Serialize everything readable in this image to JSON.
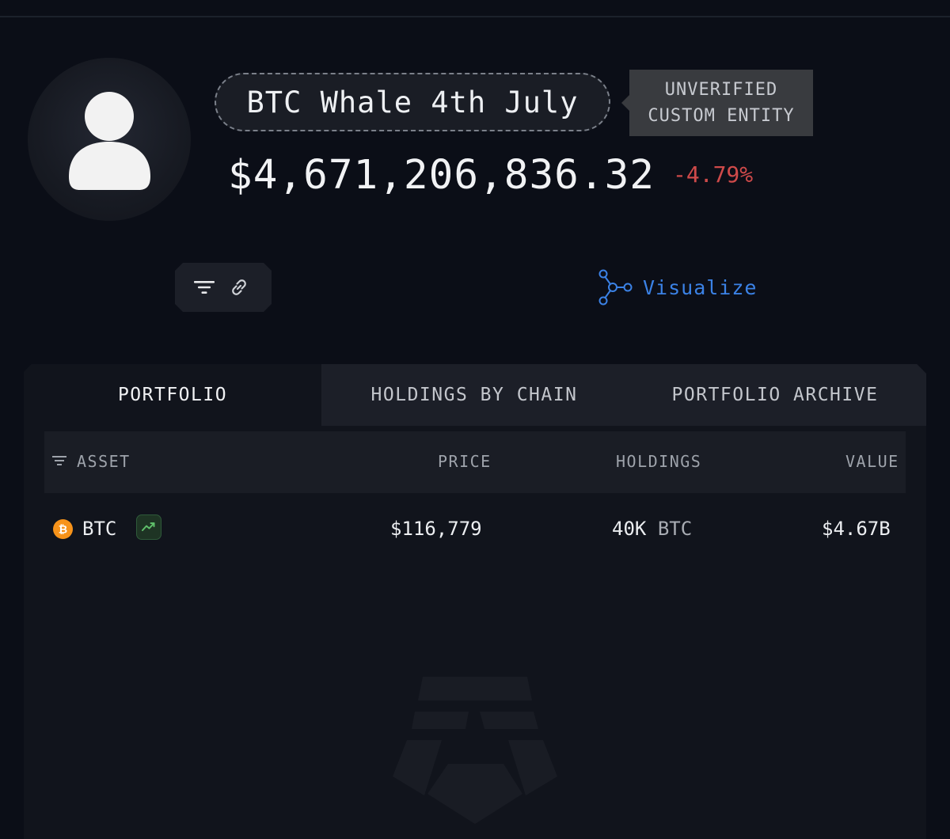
{
  "entity": {
    "name": "BTC Whale 4th July",
    "tag_line1": "UNVERIFIED",
    "tag_line2": "CUSTOM ENTITY",
    "total_value": "$4,671,206,836.32",
    "change": "-4.79%"
  },
  "toolbar": {
    "filter_icon": "filter-icon",
    "link_icon": "link-icon",
    "visualize_label": "Visualize",
    "visualize_icon": "network-graph-icon"
  },
  "tabs": [
    {
      "label": "PORTFOLIO",
      "active": true
    },
    {
      "label": "HOLDINGS BY CHAIN",
      "active": false
    },
    {
      "label": "PORTFOLIO ARCHIVE",
      "active": false
    }
  ],
  "table": {
    "headers": {
      "asset": "ASSET",
      "price": "PRICE",
      "holdings": "HOLDINGS",
      "value": "VALUE"
    },
    "rows": [
      {
        "asset": "BTC",
        "price": "$116,779",
        "holdings_amount": "40K",
        "holdings_unit": "BTC",
        "value": "$4.67B",
        "icon": "bitcoin-icon"
      }
    ]
  },
  "colors": {
    "background": "#0b0e17",
    "negative": "#cf4a4a",
    "accent": "#3b82e6",
    "bitcoin": "#f7931a",
    "trend_positive": "#4caf50"
  }
}
